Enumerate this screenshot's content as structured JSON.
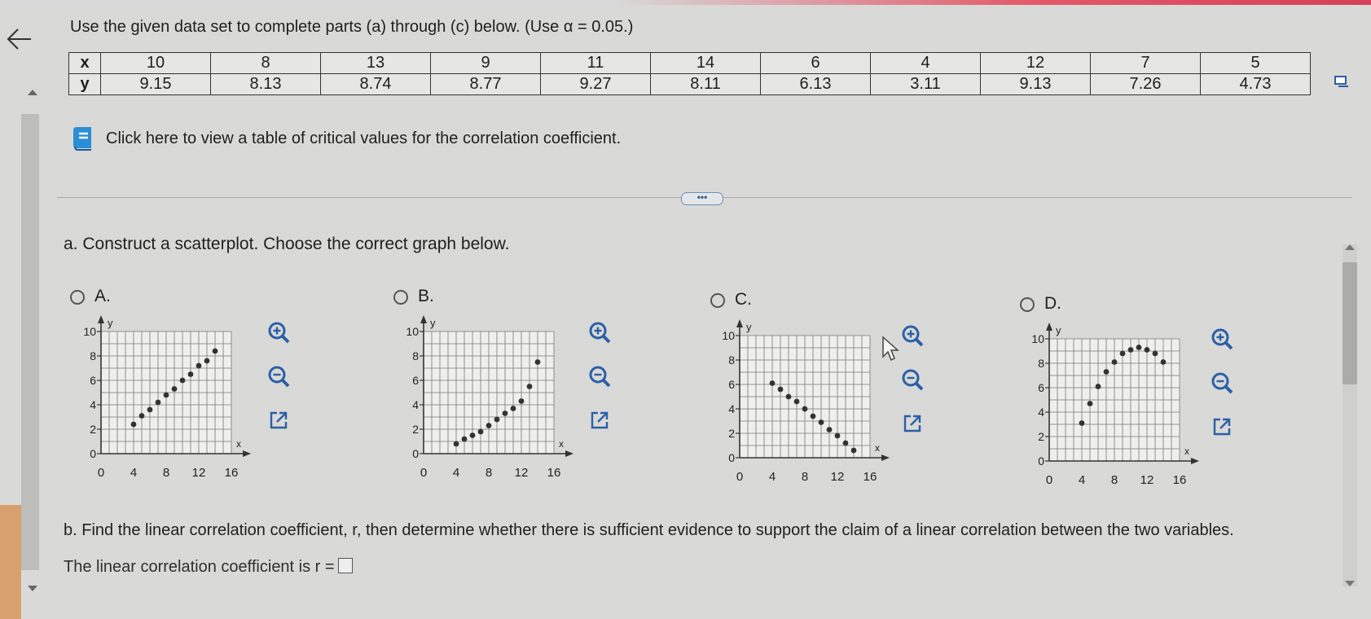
{
  "instruction": "Use the given data set to complete parts (a) through (c) below. (Use α = 0.05.)",
  "data_table": {
    "x_label": "x",
    "y_label": "y",
    "x": [
      "10",
      "8",
      "13",
      "9",
      "11",
      "14",
      "6",
      "4",
      "12",
      "7",
      "5"
    ],
    "y": [
      "9.15",
      "8.13",
      "8.74",
      "8.77",
      "9.27",
      "8.11",
      "6.13",
      "3.11",
      "9.13",
      "7.26",
      "4.73"
    ]
  },
  "critical_values_link": "Click here to view a table of critical values for the correlation coefficient.",
  "expand_button": "•••",
  "part_a": "a. Construct a scatterplot. Choose the correct graph below.",
  "options": [
    {
      "label": "A.",
      "selected": false
    },
    {
      "label": "B.",
      "selected": false
    },
    {
      "label": "C.",
      "selected": false
    },
    {
      "label": "D.",
      "selected": false
    }
  ],
  "axis": {
    "x_name": "x",
    "y_name": "y",
    "x_ticks": [
      "0",
      "4",
      "8",
      "12",
      "16"
    ],
    "y_ticks": [
      "0",
      "2",
      "4",
      "6",
      "8",
      "10"
    ]
  },
  "chart_data": [
    {
      "type": "scatter",
      "x": [
        4,
        5,
        6,
        7,
        8,
        9,
        10,
        11,
        12,
        13,
        14
      ],
      "y": [
        2.4,
        3.1,
        3.6,
        4.2,
        4.8,
        5.3,
        6.0,
        6.5,
        7.2,
        7.6,
        8.4
      ],
      "xlim": [
        0,
        16
      ],
      "ylim": [
        0,
        10
      ],
      "xlabel": "x",
      "ylabel": "y"
    },
    {
      "type": "scatter",
      "x": [
        4,
        5,
        6,
        7,
        8,
        9,
        10,
        11,
        12,
        13,
        14
      ],
      "y": [
        0.8,
        1.2,
        1.5,
        1.8,
        2.3,
        2.8,
        3.3,
        3.7,
        4.3,
        5.5,
        7.5
      ],
      "xlim": [
        0,
        16
      ],
      "ylim": [
        0,
        10
      ],
      "xlabel": "x",
      "ylabel": "y"
    },
    {
      "type": "scatter",
      "x": [
        4,
        5,
        6,
        7,
        8,
        9,
        10,
        11,
        12,
        13,
        14
      ],
      "y": [
        6.1,
        5.6,
        5.0,
        4.6,
        4.0,
        3.4,
        2.9,
        2.3,
        1.8,
        1.2,
        0.6
      ],
      "xlim": [
        0,
        16
      ],
      "ylim": [
        0,
        10
      ],
      "xlabel": "x",
      "ylabel": "y"
    },
    {
      "type": "scatter",
      "x": [
        4,
        5,
        6,
        7,
        8,
        9,
        10,
        11,
        12,
        13,
        14
      ],
      "y": [
        3.1,
        4.7,
        6.1,
        7.3,
        8.1,
        8.8,
        9.1,
        9.3,
        9.1,
        8.8,
        8.1
      ],
      "xlim": [
        0,
        16
      ],
      "ylim": [
        0,
        10
      ],
      "xlabel": "x",
      "ylabel": "y"
    }
  ],
  "part_b": "b. Find the linear correlation coefficient, r, then determine whether there is sufficient evidence to support the claim of a linear correlation between the two variables.",
  "part_b_answer_prompt": "The linear correlation coefficient is r ="
}
